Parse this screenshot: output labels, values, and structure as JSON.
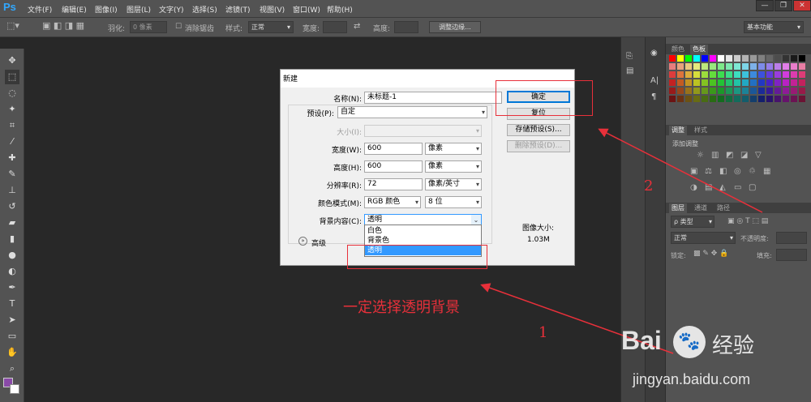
{
  "app": {
    "logo": "Ps",
    "accent": "#31a8ff"
  },
  "menubar": {
    "items": [
      "文件(F)",
      "编辑(E)",
      "图像(I)",
      "图层(L)",
      "文字(Y)",
      "选择(S)",
      "滤镜(T)",
      "视图(V)",
      "窗口(W)",
      "帮助(H)"
    ],
    "minimize": "—",
    "restore": "❐",
    "close": "✕"
  },
  "options": {
    "feather_label": "羽化:",
    "feather_value": "0 像素",
    "antialias_label": "消除锯齿",
    "style_label": "样式:",
    "style_value": "正常",
    "width_label": "宽度:",
    "height_label": "高度:",
    "refine_button": "调整边缘...",
    "workspace": "基本功能"
  },
  "dialog": {
    "title": "新建",
    "name_label": "名称(N):",
    "name_value": "未标题-1",
    "preset_label": "预设(P):",
    "preset_value": "自定",
    "size_label": "大小(I):",
    "width_label": "宽度(W):",
    "width_value": "600",
    "width_unit": "像素",
    "height_label": "高度(H):",
    "height_value": "600",
    "height_unit": "像素",
    "res_label": "分辨率(R):",
    "res_value": "72",
    "res_unit": "像素/英寸",
    "mode_label": "颜色模式(M):",
    "mode_value": "RGB 颜色",
    "depth_value": "8 位",
    "bg_label": "背景内容(C):",
    "bg_value": "透明",
    "bg_options": [
      "白色",
      "背景色",
      "透明"
    ],
    "advanced_label": "高级",
    "ok_button": "确定",
    "reset_button": "复位",
    "save_preset_button": "存储预设(S)...",
    "delete_preset_button": "删除预设(D)...",
    "image_size_label": "图像大小:",
    "image_size_value": "1.03M"
  },
  "panels": {
    "color_tabs": [
      "颜色",
      "色板"
    ],
    "adjust_tabs": [
      "调整",
      "样式"
    ],
    "adjust_title": "添加调整",
    "layers_tabs": [
      "图层",
      "通道",
      "路径"
    ],
    "layers_kind": "ρ 类型",
    "blend_mode": "正常",
    "opacity_label": "不透明度:",
    "lock_label": "锁定:",
    "fill_label": "填充:"
  },
  "annotations": {
    "instruction": "一定选择透明背景",
    "num1": "1",
    "num2": "2",
    "color": "#e8303a"
  },
  "watermark": {
    "brand": "Bai",
    "brand2": "经验",
    "url": "jingyan.baidu.com"
  }
}
